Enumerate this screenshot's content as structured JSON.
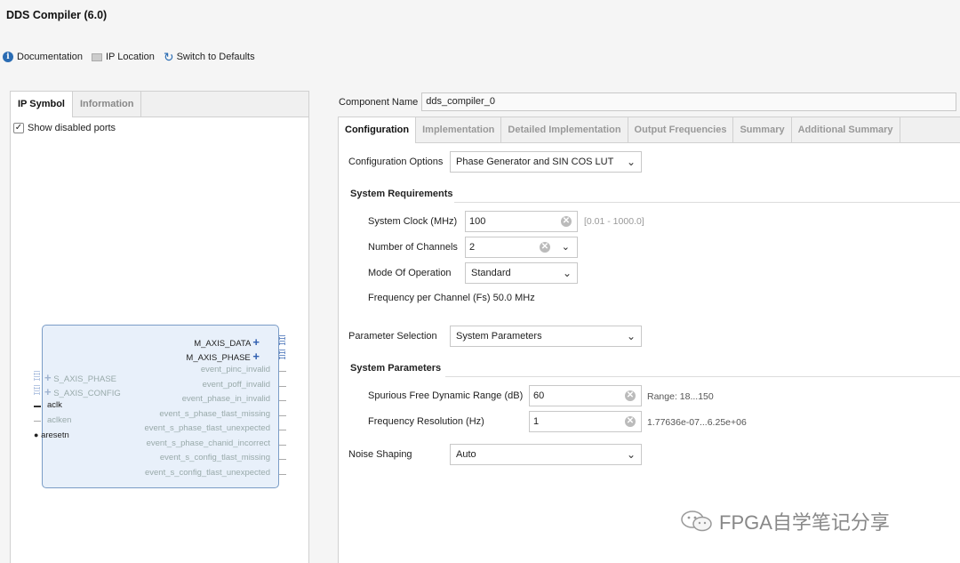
{
  "app": {
    "title": "DDS Compiler (6.0)"
  },
  "toolbar": {
    "documentation": "Documentation",
    "ip_location": "IP Location",
    "switch_defaults": "Switch to Defaults"
  },
  "left": {
    "tabs": [
      "IP Symbol",
      "Information"
    ],
    "show_disabled": "Show disabled ports",
    "ports_right": [
      {
        "name": "M_AXIS_DATA",
        "enabled": true,
        "bus": true
      },
      {
        "name": "M_AXIS_PHASE",
        "enabled": true,
        "bus": true
      },
      {
        "name": "event_pinc_invalid",
        "enabled": false
      },
      {
        "name": "event_poff_invalid",
        "enabled": false
      },
      {
        "name": "event_phase_in_invalid",
        "enabled": false
      },
      {
        "name": "event_s_phase_tlast_missing",
        "enabled": false
      },
      {
        "name": "event_s_phase_tlast_unexpected",
        "enabled": false
      },
      {
        "name": "event_s_phase_chanid_incorrect",
        "enabled": false
      },
      {
        "name": "event_s_config_tlast_missing",
        "enabled": false
      },
      {
        "name": "event_s_config_tlast_unexpected",
        "enabled": false
      }
    ],
    "ports_left": [
      {
        "name": "S_AXIS_PHASE",
        "enabled": false,
        "bus": true
      },
      {
        "name": "S_AXIS_CONFIG",
        "enabled": false,
        "bus": true
      },
      {
        "name": "aclk",
        "enabled": true
      },
      {
        "name": "aclken",
        "enabled": false
      },
      {
        "name": "aresetn",
        "enabled": true
      }
    ]
  },
  "component": {
    "label": "Component Name",
    "value": "dds_compiler_0"
  },
  "tabs": [
    "Configuration",
    "Implementation",
    "Detailed Implementation",
    "Output Frequencies",
    "Summary",
    "Additional Summary"
  ],
  "config": {
    "options_label": "Configuration Options",
    "options_value": "Phase Generator and SIN COS LUT",
    "sysreq_title": "System Requirements",
    "clock_label": "System Clock (MHz)",
    "clock_value": "100",
    "clock_range": "[0.01 - 1000.0]",
    "channels_label": "Number of Channels",
    "channels_value": "2",
    "mode_label": "Mode Of Operation",
    "mode_value": "Standard",
    "freq_per_channel": "Frequency per Channel (Fs) 50.0 MHz",
    "param_sel_label": "Parameter Selection",
    "param_sel_value": "System Parameters",
    "sysparam_title": "System Parameters",
    "sfdr_label": "Spurious Free Dynamic Range (dB)",
    "sfdr_value": "60",
    "sfdr_range": "Range: 18...150",
    "freqres_label": "Frequency Resolution (Hz)",
    "freqres_value": "1",
    "freqres_range": "1.77636e-07...6.25e+06",
    "noise_label": "Noise Shaping",
    "noise_value": "Auto"
  },
  "watermark": "FPGA自学笔记分享"
}
